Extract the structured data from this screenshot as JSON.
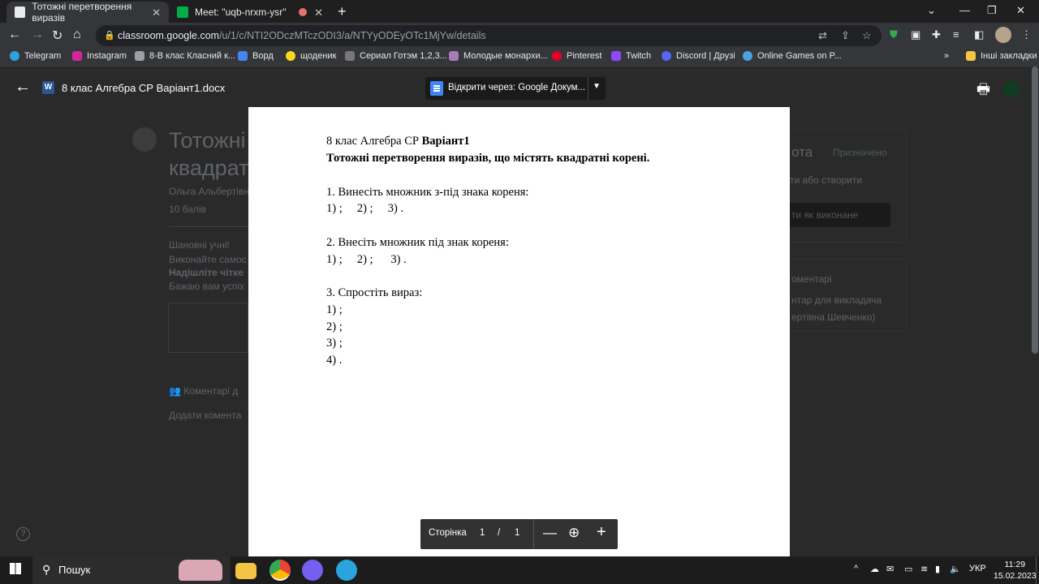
{
  "tabs": [
    {
      "title": "Тотожні перетворення виразів",
      "active": true
    },
    {
      "title": "Meet: \"uqb-nrxm-ysr\"",
      "active": false
    }
  ],
  "address": {
    "host": "classroom.google.com",
    "path": "/u/1/c/NTI2ODczMTczODI3/a/NTYyODEyOTc1MjYw/details"
  },
  "bookmarks": [
    {
      "label": "Telegram",
      "color": "#2aa3df"
    },
    {
      "label": "Instagram",
      "color": "#d6249f"
    },
    {
      "label": "8-В клас Класний к...",
      "color": "#9aa0a6"
    },
    {
      "label": "Ворд",
      "color": "#4285f4"
    },
    {
      "label": "щоденик",
      "color": "#f9d71c"
    },
    {
      "label": "Сериал Готэм 1,2,3...",
      "color": "#777777"
    },
    {
      "label": "Молодые монархи...",
      "color": "#a67cb8"
    },
    {
      "label": "Pinterest",
      "color": "#e60023"
    },
    {
      "label": "Twitch",
      "color": "#9146ff"
    },
    {
      "label": "Discord | Друзі",
      "color": "#5865f2"
    },
    {
      "label": "Online Games on P...",
      "color": "#4aa3df"
    }
  ],
  "bookmarks_more": "»",
  "other_bookmarks": "Інші закладки",
  "viewer": {
    "file_name": "8 клас Алгебра СР Варіант1.docx",
    "open_with": "Відкрити через: Google Докум..."
  },
  "document": {
    "line1_plain": "8 клас Алгебра СР ",
    "line1_bold": "Варіант1",
    "title": "Тотожні перетворення виразів, що містять квадратні корені.",
    "q1": "1. Винесіть множник з-під знака кореня:",
    "q1_items": "1) ;     2) ;     3) .",
    "q2": "2. Внесіть множник під знак кореня:",
    "q2_items": "1) ;     2) ;      3) .",
    "q3": "3. Спростіть вираз:",
    "q3_items": [
      "1) ;",
      "2) ;",
      "3) ;",
      "4) ."
    ]
  },
  "page_control": {
    "label": "Сторінка",
    "current": "1",
    "separator": "/",
    "total": "1"
  },
  "background": {
    "title1": "Тотожні",
    "title2": "квадрат",
    "author": "Ольга Альбертівн",
    "points": "10 балів",
    "text1": "Шановні учні!",
    "text2": "Виконайте самос",
    "text3": "Надішліте чітке",
    "text4": "Бажаю вам успіх",
    "comments": "Коментарі д",
    "add_comment": "Додати комента",
    "assigned": "Призначено",
    "work": "ота",
    "add_create": "ти або створити",
    "mark_done": "ти як виконане",
    "private_comments": "оментарі",
    "comment_teacher": "нтар для викладача",
    "teacher_name": "ертівна Шевченко)"
  },
  "taskbar": {
    "search": "Пошук",
    "lang": "УКР",
    "time": "11:29",
    "date": "15.02.2023"
  }
}
